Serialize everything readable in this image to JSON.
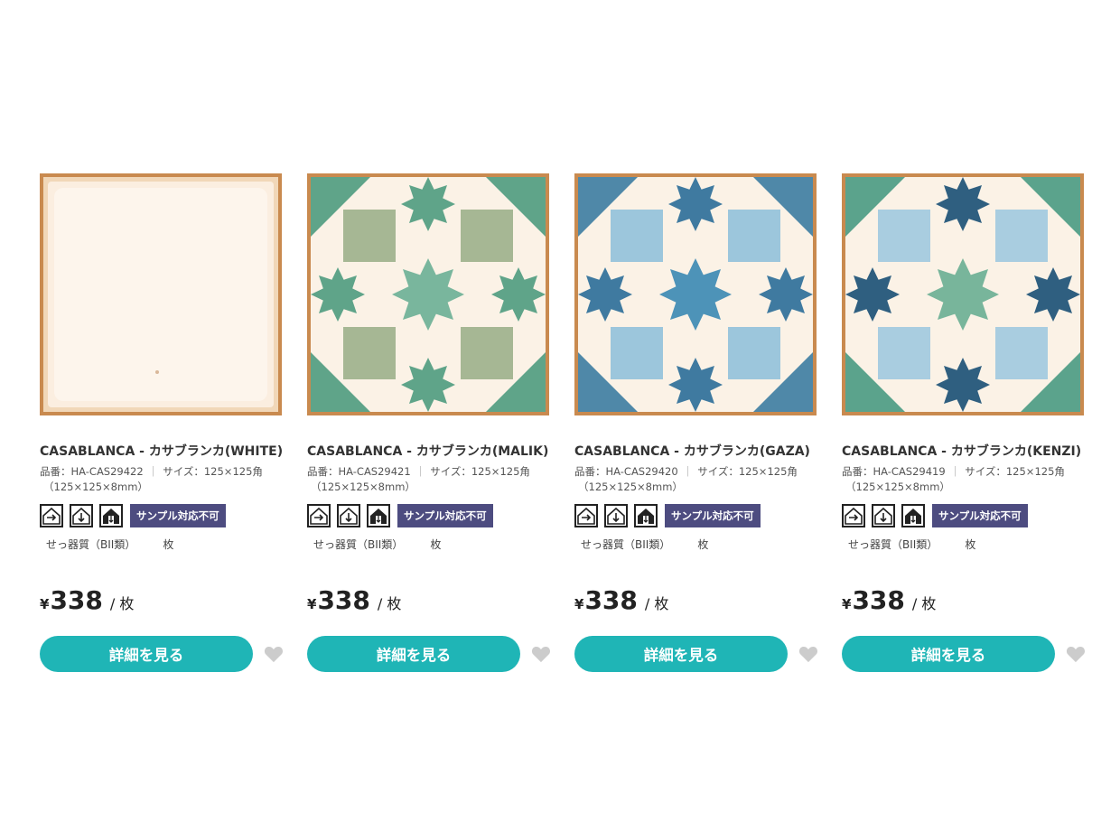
{
  "colors": {
    "accent": "#1fb5b6",
    "badge": "#4d4c80",
    "heart": "#cccccc"
  },
  "labels": {
    "sku_prefix": "品番：",
    "size_prefix": "サイズ：",
    "separator": "｜",
    "no_sample": "サンプル対応不可",
    "material": "せっ器質（BII類）",
    "unit_small": "枚",
    "currency": "¥",
    "per_unit": "/ 枚",
    "detail_button": "詳細を見る"
  },
  "icons": [
    "wall-tile-icon",
    "floor-tile-icon",
    "exterior-tile-icon",
    "heart-icon"
  ],
  "products": [
    {
      "name": "CASABLANCA - カサブランカ(WHITE)",
      "sku": "HA-CAS29422",
      "size": "125×125角",
      "dimensions": "（125×125×8mm）",
      "price": "338",
      "tile": "white"
    },
    {
      "name": "CASABLANCA - カサブランカ(MALIK)",
      "sku": "HA-CAS29421",
      "size": "125×125角",
      "dimensions": "（125×125×8mm）",
      "price": "338",
      "tile": "malik"
    },
    {
      "name": "CASABLANCA - カサブランカ(GAZA)",
      "sku": "HA-CAS29420",
      "size": "125×125角",
      "dimensions": "（125×125×8mm）",
      "price": "338",
      "tile": "gaza"
    },
    {
      "name": "CASABLANCA - カサブランカ(KENZI)",
      "sku": "HA-CAS29419",
      "size": "125×125角",
      "dimensions": "（125×125×8mm）",
      "price": "338",
      "tile": "kenzi"
    }
  ]
}
